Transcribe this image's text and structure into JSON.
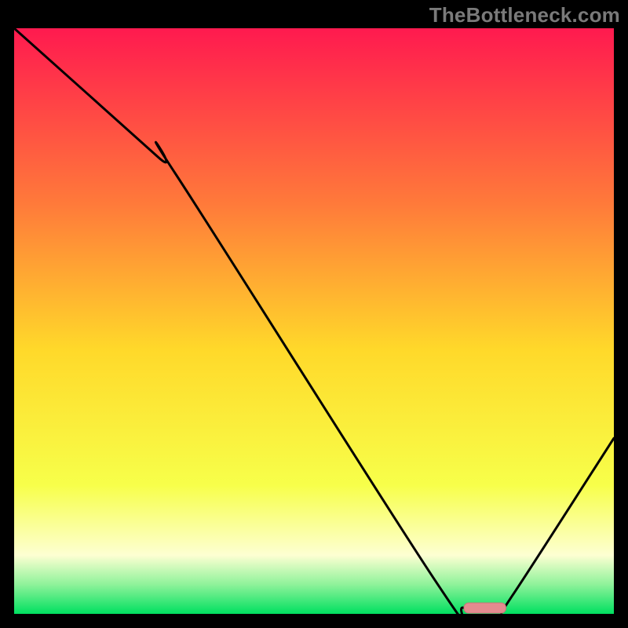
{
  "watermark": "TheBottleneck.com",
  "colors": {
    "frame": "#000000",
    "watermark_text": "#7a7a7a",
    "grad_top": "#ff1a4f",
    "grad_mid1": "#ff7a3a",
    "grad_mid2": "#ffd92a",
    "grad_mid3": "#f7ff4a",
    "grad_bottom_pale": "#fdffd2",
    "grad_green1": "#8ef29a",
    "grad_green2": "#00e060",
    "curve_stroke": "#000000",
    "marker_fill": "#e38b8f",
    "marker_stroke": "#c97478"
  },
  "chart_data": {
    "type": "line",
    "title": "",
    "xlabel": "",
    "ylabel": "",
    "xlim": [
      0,
      100
    ],
    "ylim": [
      0,
      100
    ],
    "x": [
      0,
      24,
      27,
      70,
      75,
      81,
      83,
      100
    ],
    "values": [
      100,
      78,
      75,
      6,
      1,
      1,
      3,
      30
    ],
    "annotations": [
      {
        "kind": "marker",
        "x_start": 75,
        "x_end": 82,
        "y": 1
      }
    ]
  }
}
